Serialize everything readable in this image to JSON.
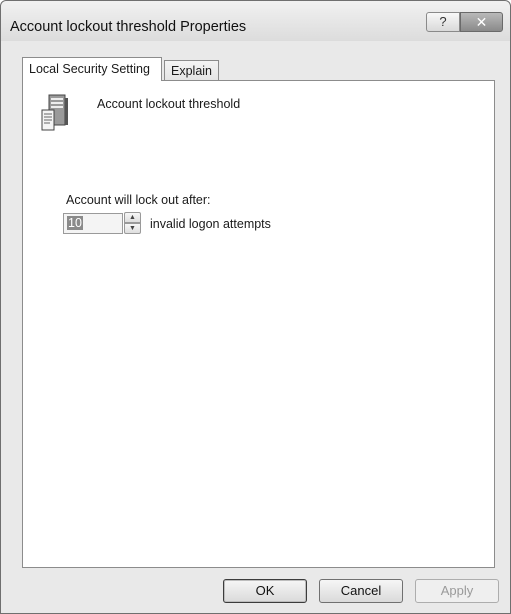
{
  "window": {
    "title": "Account lockout threshold Properties",
    "help_glyph": "?",
    "close_glyph": "✕"
  },
  "tabs": [
    {
      "label": "Local Security Setting",
      "active": true
    },
    {
      "label": "Explain",
      "active": false
    }
  ],
  "setting": {
    "icon": "server-icon",
    "name": "Account lockout threshold"
  },
  "lockout": {
    "label": "Account will lock out after:",
    "value": "10",
    "suffix": "invalid logon attempts",
    "up_glyph": "▲",
    "down_glyph": "▼"
  },
  "buttons": {
    "ok": "OK",
    "cancel": "Cancel",
    "apply": "Apply"
  }
}
